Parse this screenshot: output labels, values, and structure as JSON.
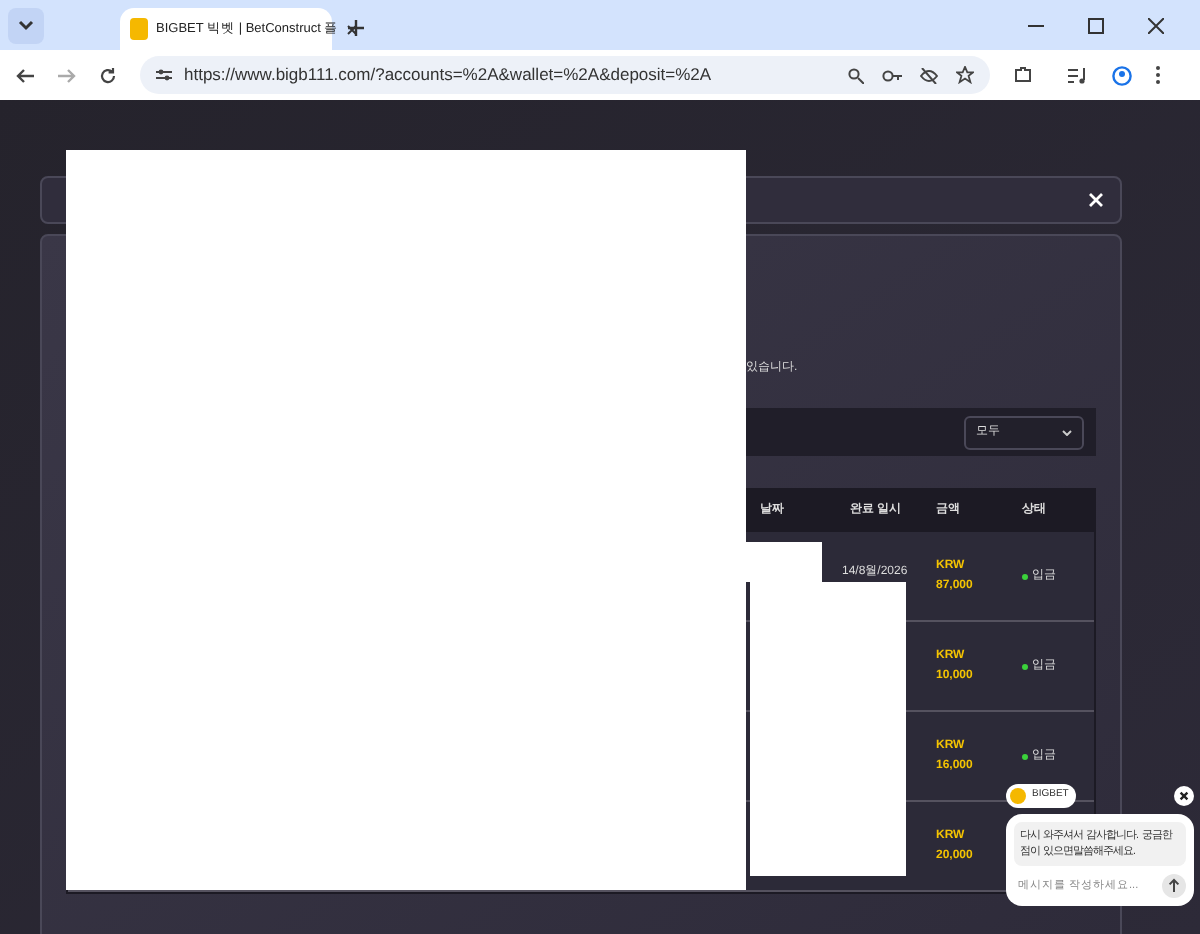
{
  "browser": {
    "tab_title": "BIGBET 빅벳 | BetConstruct 플",
    "url": "https://www.bigb111.com/?accounts=%2A&wallet=%2A&deposit=%2A"
  },
  "dialog": {
    "notice": "있습니다.",
    "filter": {
      "value": "모두"
    },
    "table": {
      "columns": [
        "날짜",
        "완료 일시",
        "금액",
        "상태"
      ],
      "rows": [
        {
          "date": "14/8월/2026",
          "currency": "KRW",
          "amount": "87,000",
          "status": "입금"
        },
        {
          "currency": "KRW",
          "amount": "10,000",
          "status": "입금"
        },
        {
          "currency": "KRW",
          "amount": "16,000",
          "status": "입금"
        },
        {
          "currency": "KRW",
          "amount": "20,000"
        }
      ]
    }
  },
  "chat": {
    "brand": "BIGBET",
    "message": "다시 와주셔서 감사합니다. 궁금한점이 있으면말씀해주세요.",
    "placeholder": "메시지를 작성하세요..."
  }
}
